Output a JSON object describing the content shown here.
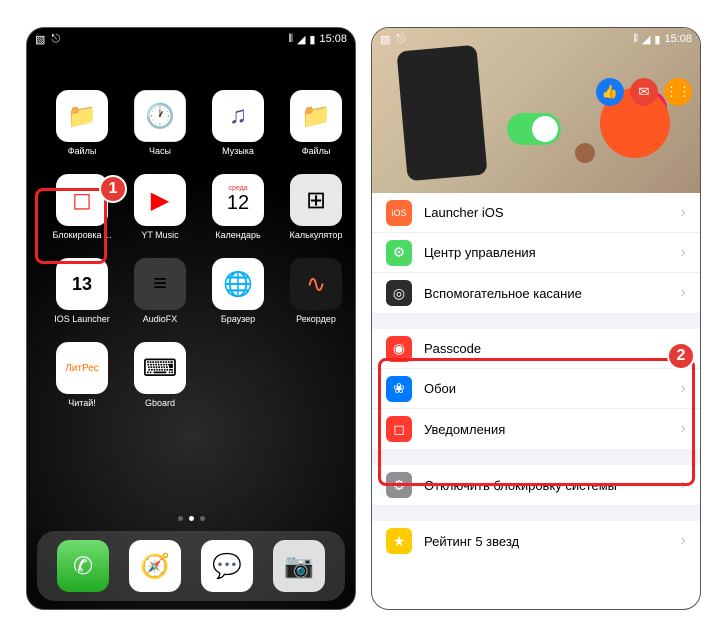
{
  "status": {
    "time": "15:08"
  },
  "homescreen": {
    "apps": [
      {
        "label": "Файлы",
        "icon": "folder-icon",
        "cls": "ic-folder"
      },
      {
        "label": "Часы",
        "icon": "clock-icon",
        "cls": "ic-clock"
      },
      {
        "label": "Музыка",
        "icon": "music-icon",
        "cls": "ic-music"
      },
      {
        "label": "Файлы",
        "icon": "folder-icon",
        "cls": "ic-folder"
      },
      {
        "label": "Блокировка ...",
        "icon": "lock-app-icon",
        "cls": "ic-lock"
      },
      {
        "label": "YT Music",
        "icon": "yt-music-icon",
        "cls": "ic-yt"
      },
      {
        "label": "Календарь",
        "icon": "calendar-icon",
        "cls": "ic-cal",
        "day_label": "среда",
        "day_num": "12"
      },
      {
        "label": "Калькулятор",
        "icon": "calculator-icon",
        "cls": "ic-calc"
      },
      {
        "label": "IOS Launcher",
        "icon": "ios-launcher-icon",
        "cls": "ic-13",
        "text": "13"
      },
      {
        "label": "AudioFX",
        "icon": "audiofx-icon",
        "cls": "ic-audiofx"
      },
      {
        "label": "Браузер",
        "icon": "browser-icon",
        "cls": "ic-browser"
      },
      {
        "label": "Рекордер",
        "icon": "recorder-icon",
        "cls": "ic-rec"
      },
      {
        "label": "Читай!",
        "icon": "litres-icon",
        "cls": "ic-litres",
        "text": "ЛитРес"
      },
      {
        "label": "Gboard",
        "icon": "gboard-icon",
        "cls": "ic-gboard"
      }
    ],
    "dock": [
      {
        "icon": "phone-icon",
        "cls": "ic-phone"
      },
      {
        "icon": "safari-icon",
        "cls": "ic-safari"
      },
      {
        "icon": "messages-icon",
        "cls": "ic-msg"
      },
      {
        "icon": "camera-icon",
        "cls": "ic-camera"
      }
    ]
  },
  "settings": {
    "groups": [
      [
        {
          "label": "Launcher iOS",
          "icon": "launcher-ios-icon",
          "cls": "ic-orange",
          "glyph": "iOS"
        },
        {
          "label": "Центр управления",
          "icon": "control-center-icon",
          "cls": "ic-green",
          "glyph": "⚙"
        },
        {
          "label": "Вспомогательное касание",
          "icon": "assistive-touch-icon",
          "cls": "ic-dark",
          "glyph": "◎"
        }
      ],
      [
        {
          "label": "Passcode",
          "icon": "passcode-icon",
          "cls": "ic-red",
          "glyph": "◉"
        },
        {
          "label": "Обои",
          "icon": "wallpaper-icon",
          "cls": "ic-blue",
          "glyph": "❀"
        },
        {
          "label": "Уведомления",
          "icon": "notifications-icon",
          "cls": "ic-red",
          "glyph": "◻"
        }
      ],
      [
        {
          "label": "Отключить блокировку системы",
          "icon": "disable-lock-icon",
          "cls": "ic-gray",
          "glyph": "⚙"
        }
      ],
      [
        {
          "label": "Рейтинг 5 звезд",
          "icon": "rate-icon",
          "cls": "ic-yellow",
          "glyph": "★"
        }
      ]
    ]
  },
  "annotations": {
    "badge1": "1",
    "badge2": "2"
  }
}
